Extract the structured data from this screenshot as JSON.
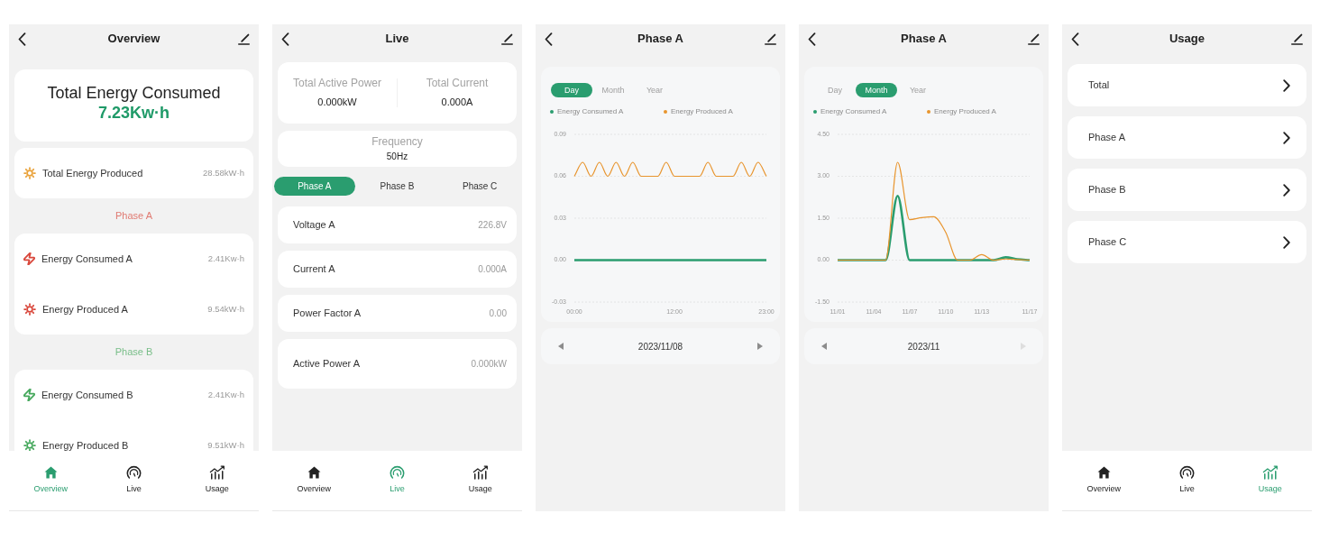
{
  "screens": [
    {
      "kind": "overview",
      "title": "Overview",
      "total_consumed": {
        "label": "Total Energy Consumed",
        "value": "7.23Kw·h"
      },
      "total_produced": {
        "label": "Total Energy Produced",
        "value": "28.58kW·h"
      },
      "phases": [
        {
          "title": "Phase A",
          "color": "#d9473b",
          "rows": [
            {
              "kind": "consumed",
              "label": "Energy Consumed A",
              "value": "2.41Kw·h"
            },
            {
              "kind": "produced",
              "label": "Energy Produced A",
              "value": "9.54kW·h"
            }
          ]
        },
        {
          "title": "Phase B",
          "color": "#45a85c",
          "rows": [
            {
              "kind": "consumed",
              "label": "Energy Consumed B",
              "value": "2.41Kw·h"
            },
            {
              "kind": "produced",
              "label": "Energy Produced B",
              "value": "9.51kW·h"
            }
          ]
        }
      ],
      "nav": [
        {
          "label": "Overview",
          "selected": true
        },
        {
          "label": "Live",
          "selected": false
        },
        {
          "label": "Usage",
          "selected": false
        }
      ]
    },
    {
      "kind": "live",
      "title": "Live",
      "summary": [
        {
          "label": "Total Active Power",
          "value": "0.000kW"
        },
        {
          "label": "Total Current",
          "value": "0.000A"
        }
      ],
      "frequency": {
        "label": "Frequency",
        "value": "50Hz"
      },
      "phase_tabs": [
        {
          "label": "Phase A",
          "selected": true
        },
        {
          "label": "Phase B",
          "selected": false
        },
        {
          "label": "Phase C",
          "selected": false
        }
      ],
      "readings": [
        {
          "label": "Voltage A",
          "value": "226.8V"
        },
        {
          "label": "Current A",
          "value": "0.000A"
        },
        {
          "label": "Power Factor A",
          "value": "0.00"
        },
        {
          "label": "Active Power A",
          "value": "0.000kW"
        }
      ],
      "nav": [
        {
          "label": "Overview",
          "selected": false
        },
        {
          "label": "Live",
          "selected": true
        },
        {
          "label": "Usage",
          "selected": false
        }
      ]
    },
    {
      "kind": "chart",
      "title": "Phase A",
      "periods": [
        {
          "label": "Day",
          "selected": true
        },
        {
          "label": "Month",
          "selected": false
        },
        {
          "label": "Year",
          "selected": false
        }
      ],
      "chart_data": {
        "type": "line",
        "x": [
          0,
          1,
          2,
          3,
          4,
          5,
          6,
          7,
          8,
          9,
          10,
          11,
          12,
          13,
          14,
          15,
          16,
          17,
          18,
          19,
          20,
          21,
          22,
          23
        ],
        "series": [
          {
            "name": "Energy Consumed A",
            "color": "#2a9d6f",
            "values": [
              0,
              0,
              0,
              0,
              0,
              0,
              0,
              0,
              0,
              0,
              0,
              0,
              0,
              0,
              0,
              0,
              0,
              0,
              0,
              0,
              0,
              0,
              0,
              0
            ]
          },
          {
            "name": "Energy Produced A",
            "color": "#e8952e",
            "values": [
              0.06,
              0.07,
              0.06,
              0.07,
              0.06,
              0.07,
              0.06,
              0.07,
              0.06,
              0.06,
              0.06,
              0.07,
              0.06,
              0.06,
              0.06,
              0.06,
              0.07,
              0.06,
              0.06,
              0.06,
              0.07,
              0.06,
              0.07,
              0.06
            ]
          }
        ],
        "xlim": [
          0,
          23
        ],
        "ylim": [
          -0.03,
          0.09
        ],
        "xticks": [
          {
            "value": 0,
            "label": "00:00"
          },
          {
            "value": 12,
            "label": "12:00"
          },
          {
            "value": 23,
            "label": "23:00"
          }
        ],
        "yticks": [
          {
            "value": 0.09,
            "label": "0.09"
          },
          {
            "value": 0.06,
            "label": "0.06"
          },
          {
            "value": 0.03,
            "label": "0.03"
          },
          {
            "value": 0,
            "label": "0.00"
          },
          {
            "value": -0.03,
            "label": "-0.03"
          }
        ],
        "grid": true
      },
      "date_bar": {
        "label": "2023/11/08",
        "next_disabled": false
      }
    },
    {
      "kind": "chart",
      "title": "Phase A",
      "periods": [
        {
          "label": "Day",
          "selected": false
        },
        {
          "label": "Month",
          "selected": true
        },
        {
          "label": "Year",
          "selected": false
        }
      ],
      "chart_data": {
        "type": "line",
        "categories": [
          "11/01",
          null,
          null,
          "11/04",
          null,
          null,
          "11/07",
          null,
          null,
          "11/10",
          null,
          null,
          "11/13",
          null,
          null,
          null,
          "11/17"
        ],
        "series": [
          {
            "name": "Energy Consumed A",
            "color": "#2a9d6f",
            "values": [
              0,
              0,
              0,
              0,
              0,
              2.3,
              0,
              0,
              0,
              0,
              0,
              0,
              0,
              0,
              0.1,
              0.03,
              0
            ]
          },
          {
            "name": "Energy Produced A",
            "color": "#e8952e",
            "values": [
              0,
              0,
              0,
              0,
              0,
              3.5,
              1.45,
              1.52,
              1.55,
              1.0,
              0,
              0,
              0.2,
              0,
              0.04,
              0.02,
              0
            ]
          }
        ],
        "ylim": [
          -1.5,
          4.5
        ],
        "yticks": [
          {
            "value": 4.5,
            "label": "4.50"
          },
          {
            "value": 3,
            "label": "3.00"
          },
          {
            "value": 1.5,
            "label": "1.50"
          },
          {
            "value": 0,
            "label": "0.00"
          },
          {
            "value": -1.5,
            "label": "-1.50"
          }
        ],
        "grid": true
      },
      "date_bar": {
        "label": "2023/11",
        "next_disabled": true
      }
    },
    {
      "kind": "usage",
      "title": "Usage",
      "items": [
        {
          "label": "Total"
        },
        {
          "label": "Phase A"
        },
        {
          "label": "Phase B"
        },
        {
          "label": "Phase C"
        }
      ],
      "nav": [
        {
          "label": "Overview",
          "selected": false
        },
        {
          "label": "Live",
          "selected": false
        },
        {
          "label": "Usage",
          "selected": true
        }
      ]
    }
  ]
}
